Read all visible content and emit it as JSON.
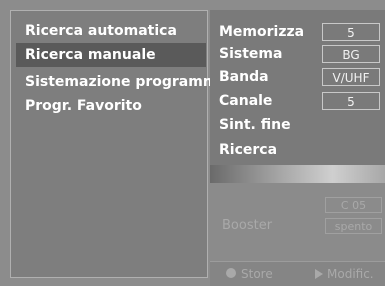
{
  "menu": {
    "items": [
      {
        "label": "Ricerca automatica",
        "selected": false
      },
      {
        "label": "Ricerca manuale",
        "selected": true
      },
      {
        "label": "Sistemazione programmi",
        "selected": false
      },
      {
        "label": "Progr. Favorito",
        "selected": false
      }
    ]
  },
  "settings": {
    "memorizza": {
      "label": "Memorizza",
      "value": "5"
    },
    "sistema": {
      "label": "Sistema",
      "value": "BG"
    },
    "banda": {
      "label": "Banda",
      "value": "V/UHF"
    },
    "canale": {
      "label": "Canale",
      "value": "5"
    },
    "sint_fine": {
      "label": "Sint. fine"
    },
    "ricerca": {
      "label": "Ricerca"
    }
  },
  "lower": {
    "channel_value": "C 05",
    "booster": {
      "label": "Booster",
      "value": "spento"
    }
  },
  "bottom_bar": {
    "store_label": "Store",
    "modify_label": "Modific."
  }
}
